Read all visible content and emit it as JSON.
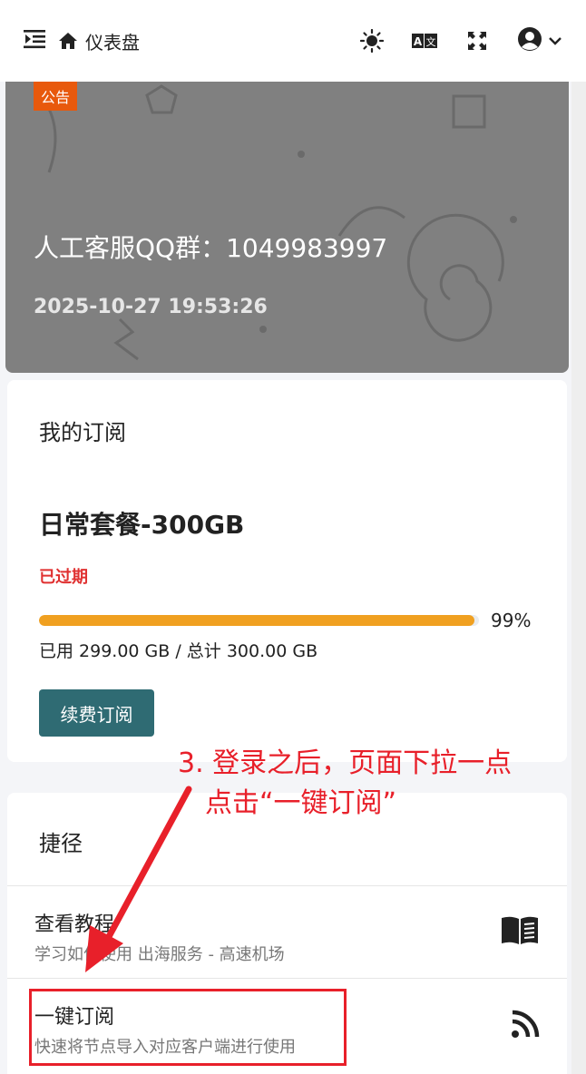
{
  "header": {
    "title": "仪表盘",
    "icons": [
      "menu-collapse-icon",
      "home-icon",
      "sun-icon",
      "translate-icon",
      "fullscreen-icon",
      "user-icon",
      "chevron-down-icon"
    ]
  },
  "notice": {
    "tag": "公告",
    "headline": "人工客服QQ群：1049983997",
    "date": "2025-10-27 19:53:26"
  },
  "subscription": {
    "title": "我的订阅",
    "plan_name": "日常套餐-300GB",
    "status": "已过期",
    "usage_percent": 99,
    "usage_percent_label": "99%",
    "usage_text": "已用 299.00 GB / 总计 300.00 GB",
    "renew_label": "续费订阅"
  },
  "shortcuts": {
    "title": "捷径",
    "items": [
      {
        "name": "查看教程",
        "desc": "学习如何使用 出海服务 - 高速机场",
        "icon": "book-icon"
      },
      {
        "name": "一键订阅",
        "desc": "快速将节点导入对应客户端进行使用",
        "icon": "rss-icon"
      }
    ]
  },
  "annotation": {
    "line1": "3. 登录之后，页面下拉一点",
    "line2": "点击“一键订阅”"
  },
  "colors": {
    "notice_tag": "#e8590c",
    "expired": "#e03131",
    "progress": "#f0a020",
    "renew_button": "#2f6b73",
    "annotation": "#e8202a"
  }
}
